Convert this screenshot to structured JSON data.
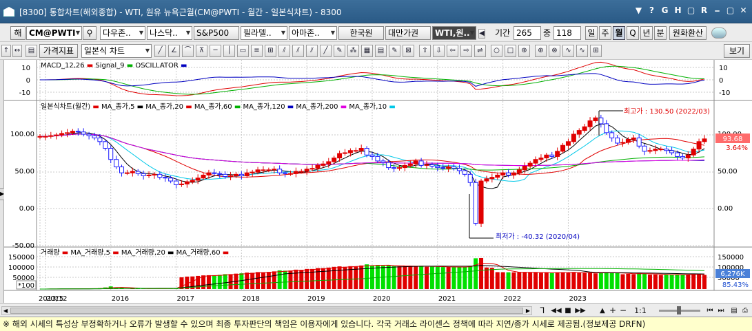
{
  "title": {
    "text": "[8300] 통합차트(해외종합) - WTI, 원유 뉴욕근월(CM@PWTI - 월간 - 일본식차트) - 8300",
    "buttons": [
      "▼",
      "?",
      "G",
      "H",
      "▢",
      "R",
      "⎯",
      "▢",
      "✕"
    ]
  },
  "toolbar1": {
    "main_label": "해",
    "code_value": "CM@PWTI",
    "markets": [
      "다우존..",
      "나스닥..",
      "S&P500",
      "필라델..",
      "아마존..",
      "한국원",
      "대만가권",
      "WTI,원.."
    ],
    "period_label": "기간",
    "period_value": "265",
    "count_label": "중",
    "count_value": "118",
    "intervals": [
      "일",
      "주",
      "월",
      "Q",
      "년",
      "분"
    ],
    "active_interval": "월",
    "fx_label": "원화환산"
  },
  "toolbar2": {
    "price_indicator": "가격지표",
    "chart_type": "일본식 차트",
    "view_label": "보기"
  },
  "macd_panel": {
    "legend": [
      "MACD_12,26",
      "Signal_9",
      "OSCILLATOR"
    ],
    "legend_colors": [
      "#e00000",
      "#00b000",
      "#0000c0"
    ],
    "ticks": [
      "10",
      "0",
      "-10"
    ]
  },
  "price_panel": {
    "legend": [
      "일본식차트(월간)",
      "MA_종가,5",
      "MA_종가,20",
      "MA_종가,60",
      "MA_종가,120",
      "MA_종가,200",
      "MA_종가,10"
    ],
    "legend_colors": [
      "#e00000",
      "#000000",
      "#e00000",
      "#00b000",
      "#0000c0",
      "#e000e0",
      "#00c8e8"
    ],
    "ticks": [
      "100.00",
      "50.00",
      "0.00",
      "-50.00"
    ],
    "right_ticks": [
      "100.00",
      "50.00",
      "0.00"
    ],
    "last_price": "93.68",
    "last_change": "3.64%",
    "high_annotation": "최고가 : 130.50 (2022/03)",
    "low_annotation": "최저가 : -40.32 (2020/04)"
  },
  "volume_panel": {
    "legend": [
      "거래량",
      "MA_거래량,5",
      "MA_거래량,20",
      "MA_거래량,60"
    ],
    "legend_colors": [
      "#e00000",
      "#e00000",
      "#000000",
      "#e00000"
    ],
    "ticks": [
      "150000",
      "100000",
      "50000"
    ],
    "unit": "*100",
    "last_volume": "6,276K",
    "last_ratio": "85.43%"
  },
  "x_axis": {
    "labels": [
      "2013/12",
      "2015",
      "2016",
      "2017",
      "2018",
      "2019",
      "2020",
      "2021",
      "2022",
      "2023"
    ]
  },
  "bottom_controls": {
    "items": [
      "⅂",
      "◀◀",
      "■",
      "▶▶",
      "▲",
      "+",
      "−",
      "1:1"
    ]
  },
  "footer": {
    "text": "※ 해외 시세의 특성상 부정확하거나 오류가 발생할 수 있으며 최종 투자판단의 책임은 이용자에게 있습니다. 각국 거래소 라이센스 정책에 따라 지연/종가 시세로 제공됨.(정보제공 DRFN)"
  },
  "colors": {
    "up": "#e00000",
    "down": "#1a1aff",
    "volume_up": "#e00000",
    "volume_down": "#00e000",
    "title_bg": "#2f6290"
  },
  "chart_data": {
    "type": "candlestick",
    "x_start": "2013-12",
    "interval": "month",
    "close": [
      97,
      97,
      98,
      99,
      101,
      102,
      104,
      103,
      100,
      98,
      95,
      90,
      81,
      66,
      56,
      48,
      48,
      50,
      47,
      44,
      45,
      46,
      42,
      41,
      37,
      32,
      33,
      36,
      38,
      41,
      45,
      48,
      47,
      46,
      43,
      44,
      46,
      44,
      48,
      49,
      52,
      52,
      52,
      53,
      48,
      47,
      47,
      50,
      50,
      53,
      54,
      58,
      60,
      63,
      68,
      74,
      75,
      78,
      78,
      81,
      72,
      70,
      64,
      62,
      55,
      54,
      55,
      58,
      60,
      64,
      58,
      59,
      57,
      55,
      54,
      56,
      54,
      51,
      46,
      35,
      -20,
      37,
      40,
      42,
      45,
      48,
      45,
      48,
      52,
      57,
      61,
      66,
      68,
      72,
      70,
      77,
      85,
      90,
      100,
      105,
      110,
      118,
      122,
      114,
      102,
      95,
      88,
      89,
      93,
      95,
      84,
      77,
      78,
      80,
      80,
      78,
      75,
      70,
      68,
      72,
      80,
      90,
      93.68
    ],
    "high_value": 130.5,
    "high_date": "2022/03",
    "low_value": -40.32,
    "low_date": "2020/04"
  }
}
